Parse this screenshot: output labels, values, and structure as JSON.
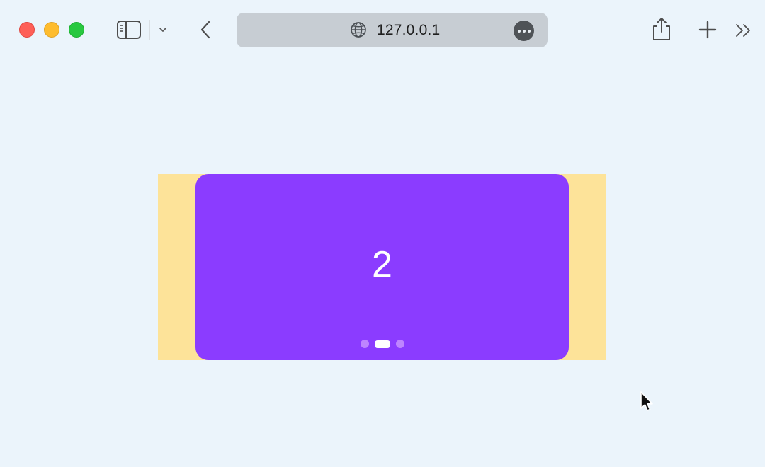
{
  "browser": {
    "url": "127.0.0.1",
    "colors": {
      "close": "#fe5f57",
      "minimize": "#febc2e",
      "zoom": "#28c840",
      "urlbar": "#c7cdd3",
      "background": "#ebf4fb"
    },
    "icons": [
      "sidebar-icon",
      "chevron-down-icon",
      "back-chevron-icon",
      "globe-icon",
      "more-icon",
      "share-icon",
      "plus-icon",
      "double-chevron-icon"
    ]
  },
  "carousel": {
    "current_slide_label": "2",
    "slide_count": 3,
    "active_index": 1,
    "colors": {
      "slide": "#8b3cff",
      "backdrop": "#fde399",
      "dot": "#c38dff",
      "dot_active": "#ffffff"
    }
  }
}
